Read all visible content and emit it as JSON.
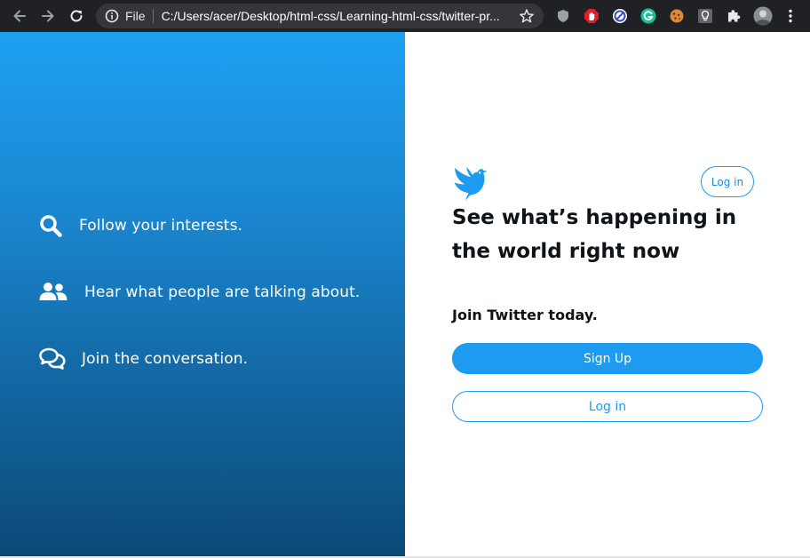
{
  "browser": {
    "scheme_label": "File",
    "url": "C:/Users/acer/Desktop/html-css/Learning-html-css/twitter-pr...",
    "chrome_bg": "#202124",
    "omnibox_bg": "#35363a",
    "extensions": [
      "shield-icon",
      "adblock-icon",
      "block-icon",
      "grammarly-icon",
      "cookie-icon",
      "bulb-icon",
      "puzzle-icon",
      "profile-avatar",
      "menu-dots-icon"
    ]
  },
  "left": {
    "gradient_top": "#1da1f2",
    "gradient_bottom": "#0a4a76",
    "features": [
      {
        "icon": "search-icon",
        "text": "Follow your interests."
      },
      {
        "icon": "people-icon",
        "text": "Hear what people are talking about."
      },
      {
        "icon": "chat-icon",
        "text": "Join the conversation."
      }
    ]
  },
  "right": {
    "brand_color": "#1d9bf0",
    "login_top_label": "Log in",
    "headline": "See what’s happening in the world right now",
    "join_text": "Join Twitter today.",
    "signup_label": "Sign Up",
    "login_label": "Log in"
  }
}
